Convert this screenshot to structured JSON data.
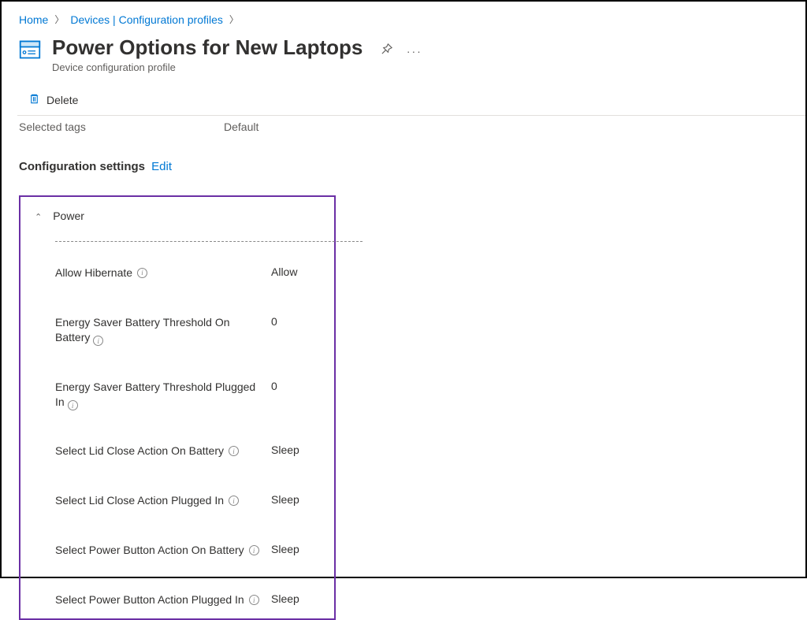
{
  "breadcrumb": {
    "home": "Home",
    "devices": "Devices | Configuration profiles"
  },
  "header": {
    "title": "Power Options for New Laptops",
    "subtitle": "Device configuration profile"
  },
  "toolbar": {
    "delete": "Delete"
  },
  "tags_row": {
    "label": "Selected tags",
    "value": "Default"
  },
  "section": {
    "title": "Configuration settings",
    "edit": "Edit"
  },
  "panel": {
    "title": "Power",
    "settings": [
      {
        "name": "Allow Hibernate",
        "value": "Allow"
      },
      {
        "name": "Energy Saver Battery Threshold On Battery",
        "value": "0"
      },
      {
        "name": "Energy Saver Battery Threshold Plugged In",
        "value": "0"
      },
      {
        "name": "Select Lid Close Action On Battery",
        "value": "Sleep"
      },
      {
        "name": "Select Lid Close Action Plugged In",
        "value": "Sleep"
      },
      {
        "name": "Select Power Button Action On Battery",
        "value": "Sleep"
      },
      {
        "name": "Select Power Button Action Plugged In",
        "value": "Sleep"
      }
    ]
  }
}
